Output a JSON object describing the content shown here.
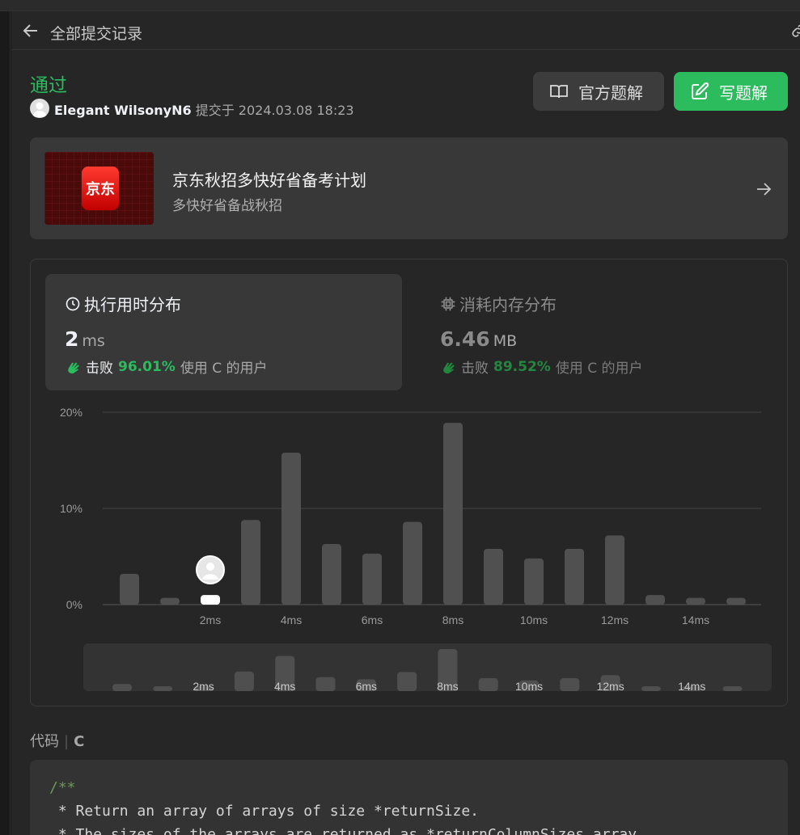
{
  "header": {
    "title": "全部提交记录",
    "back_icon": "arrow-left-icon"
  },
  "submission": {
    "status": "通过",
    "user": "Elegant WilsonyN6",
    "submitted_text": "提交于 2024.03.08 18:23"
  },
  "actions": {
    "official_label": "官方题解",
    "write_label": "写题解"
  },
  "promo": {
    "logo_text": "京东",
    "title": "京东秋招多快好省备考计划",
    "subtitle": "多快好省备战秋招"
  },
  "runtime": {
    "title": "执行用时分布",
    "value": "2",
    "unit": "ms",
    "beat_label": "击败",
    "beat_pct": "96.01%",
    "beat_rest": "使用 C 的用户"
  },
  "memory": {
    "title": "消耗内存分布",
    "value": "6.46",
    "unit": "MB",
    "beat_label": "击败",
    "beat_pct": "89.52%",
    "beat_rest": "使用 C 的用户"
  },
  "chart_data": {
    "type": "bar",
    "title": "",
    "y_ticks": [
      "20%",
      "10%",
      "0%"
    ],
    "ylim": [
      0,
      20
    ],
    "x_ticks": [
      "2ms",
      "4ms",
      "6ms",
      "8ms",
      "10ms",
      "12ms",
      "14ms"
    ],
    "categories": [
      "0ms",
      "1ms",
      "2ms",
      "3ms",
      "4ms",
      "5ms",
      "6ms",
      "7ms",
      "8ms",
      "9ms",
      "10ms",
      "11ms",
      "12ms",
      "13ms",
      "14ms",
      "15ms"
    ],
    "values": [
      3.2,
      0.7,
      1.0,
      8.8,
      15.8,
      6.3,
      5.3,
      8.6,
      18.9,
      5.8,
      4.8,
      5.8,
      7.2,
      1.0,
      0.7,
      0.7
    ],
    "highlight_index": 2,
    "grid": true,
    "colors": {
      "bar": "#505050",
      "highlight": "#ffffff",
      "grid": "#444444"
    }
  },
  "code_section": {
    "label": "代码",
    "lang": "C"
  },
  "code_lines": [
    "/**",
    " * Return an array of arrays of size *returnSize.",
    " * The sizes of the arrays are returned as *returnColumnSizes array."
  ]
}
